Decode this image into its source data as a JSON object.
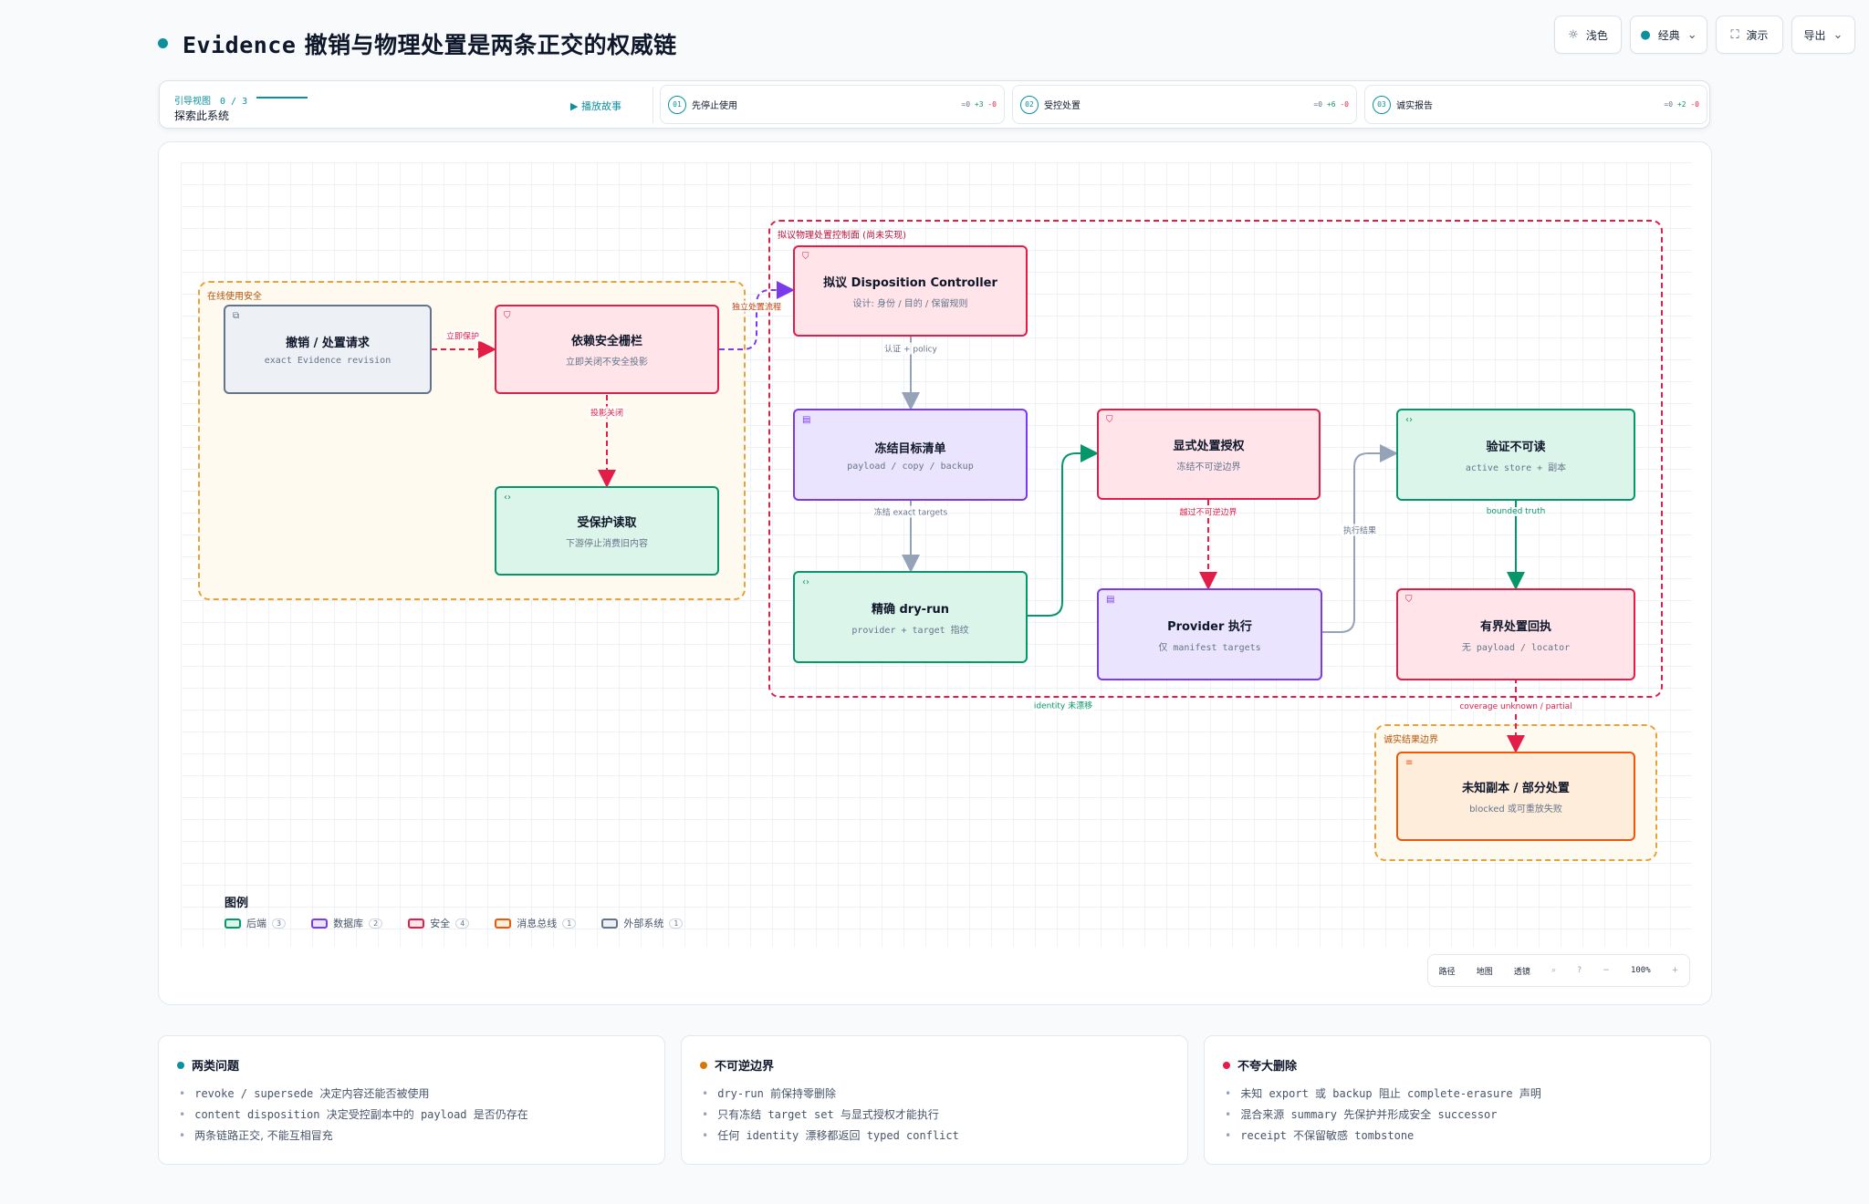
{
  "header": {
    "title_prefix": "Evidence",
    "title_rest": "撤销与物理处置是两条正交的权威链",
    "buttons": [
      {
        "label": "浅色",
        "icon": "sun-icon"
      },
      {
        "label": "经典",
        "icon": "theme-dot-icon"
      },
      {
        "label": "演示",
        "icon": "fullscreen-icon"
      },
      {
        "label": "导出",
        "icon": "chevron-down-icon"
      }
    ],
    "theme_color": "#0e8f9e"
  },
  "tour": {
    "label": "引导视图",
    "counter": "0 / 3",
    "explore": "探索此系统",
    "play": "播放故事",
    "steps": [
      {
        "num": "01",
        "label": "先停止使用",
        "d0": "=0",
        "dplus": "+3",
        "dminus": "-0"
      },
      {
        "num": "02",
        "label": "受控处置",
        "d0": "=0",
        "dplus": "+6",
        "dminus": "-0"
      },
      {
        "num": "03",
        "label": "诚实报告",
        "d0": "=0",
        "dplus": "+2",
        "dminus": "-0"
      }
    ]
  },
  "diagram": {
    "groups": {
      "online": "在线使用安全",
      "proposed": "拟议物理处置控制面 (尚未实现)",
      "honest": "诚实结果边界"
    },
    "nodes": {
      "revoke": {
        "title": "撤销 / 处置请求",
        "sub": "exact Evidence revision",
        "icon": "external-link-icon"
      },
      "fence": {
        "title": "依赖安全栅栏",
        "sub": "立即关闭不安全投影",
        "icon": "shield-icon"
      },
      "protected": {
        "title": "受保护读取",
        "sub": "下游停止消费旧内容",
        "icon": "code-icon"
      },
      "controller": {
        "title": "拟议 Disposition Controller",
        "sub": "设计: 身份 / 目的 / 保留规则",
        "icon": "shield-icon"
      },
      "freeze": {
        "title": "冻结目标清单",
        "sub": "payload / copy / backup",
        "icon": "database-icon"
      },
      "dryrun": {
        "title": "精确 dry-run",
        "sub": "provider + target 指纹",
        "icon": "code-icon"
      },
      "authorize": {
        "title": "显式处置授权",
        "sub": "冻结不可逆边界",
        "icon": "shield-icon"
      },
      "provider": {
        "title": "Provider 执行",
        "sub": "仅 manifest targets",
        "icon": "database-icon"
      },
      "verify": {
        "title": "验证不可读",
        "sub": "active store + 副本",
        "icon": "code-icon"
      },
      "receipt": {
        "title": "有界处置回执",
        "sub": "无 payload / locator",
        "icon": "shield-icon"
      },
      "unknown": {
        "title": "未知副本 / 部分处置",
        "sub": "blocked 或可重放失败",
        "icon": "queue-icon"
      }
    },
    "edges": {
      "revoke_fence": "立即保护",
      "fence_protected": "投影关闭",
      "fence_controller": "独立处置流程",
      "controller_freeze": "认证 + policy",
      "freeze_dryrun": "冻结 exact targets",
      "authorize_provider": "越过不可逆边界",
      "provider_verify": "执行结果",
      "verify_receipt": "bounded truth",
      "receipt_unknown": "coverage unknown / partial",
      "identity_drift": "identity 未漂移"
    },
    "legend": {
      "title": "图例",
      "items": [
        {
          "label": "后端",
          "count": "3",
          "color": "#059669"
        },
        {
          "label": "数据库",
          "count": "2",
          "color": "#7c3aed"
        },
        {
          "label": "安全",
          "count": "4",
          "color": "#e11d48"
        },
        {
          "label": "消息总线",
          "count": "1",
          "color": "#ea580c"
        },
        {
          "label": "外部系统",
          "count": "1",
          "color": "#64748b"
        }
      ]
    },
    "controls": {
      "path": "路径",
      "map": "地图",
      "lens": "透镜",
      "search_icon": "search-icon",
      "help_icon": "help-icon",
      "zoom_out": "−",
      "zoom": "100%",
      "zoom_in": "+"
    }
  },
  "cards": [
    {
      "title": "两类问题",
      "dot": "#0e8f9e",
      "items": [
        "revoke / supersede 决定内容还能否被使用",
        "content disposition 决定受控副本中的 payload 是否仍存在",
        "两条链路正交, 不能互相冒充"
      ]
    },
    {
      "title": "不可逆边界",
      "dot": "#d97706",
      "items": [
        "dry-run 前保持零删除",
        "只有冻结 target set 与显式授权才能执行",
        "任何 identity 漂移都返回 typed conflict"
      ]
    },
    {
      "title": "不夸大删除",
      "dot": "#e11d48",
      "items": [
        "未知 export 或 backup 阻止 complete-erasure 声明",
        "混合来源 summary 先保护并形成安全 successor",
        "receipt 不保留敏感 tombstone"
      ]
    }
  ]
}
